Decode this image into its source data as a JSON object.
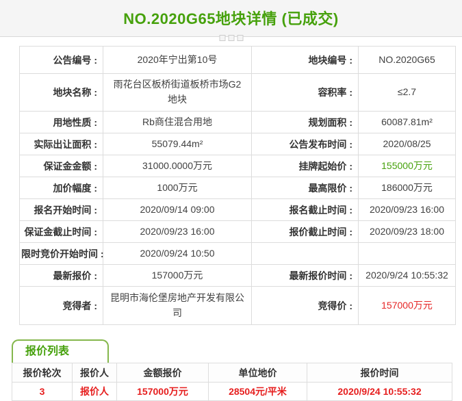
{
  "header": {
    "title": "NO.2020G65地块详情 (已成交)"
  },
  "colors": {
    "accent_green": "#46a10c",
    "highlight_red": "#e62626",
    "border_gray": "#dcdcdc"
  },
  "details": {
    "rows": [
      {
        "label1": "公告编号 :",
        "value1": "2020年宁出第10号",
        "label2": "地块编号 :",
        "value2": "NO.2020G65"
      },
      {
        "label1": "地块名称 :",
        "value1": "雨花台区板桥街道板桥市场G2地块",
        "label2": "容积率 :",
        "value2": "≤2.7"
      },
      {
        "label1": "用地性质 :",
        "value1": "Rb商住混合用地",
        "label2": "规划面积 :",
        "value2": "60087.81m²"
      },
      {
        "label1": "实际出让面积 :",
        "value1": "55079.44m²",
        "label2": "公告发布时间 :",
        "value2": "2020/08/25"
      },
      {
        "label1": "保证金金额 :",
        "value1": "31000.0000万元",
        "label2": "挂牌起始价 :",
        "value2": "155000万元"
      },
      {
        "label1": "加价幅度 :",
        "value1": "1000万元",
        "label2": "最高限价 :",
        "value2": "186000万元"
      },
      {
        "label1": "报名开始时间 :",
        "value1": "2020/09/14 09:00",
        "label2": "报名截止时间 :",
        "value2": "2020/09/23 16:00"
      },
      {
        "label1": "保证金截止时间 :",
        "value1": "2020/09/23 16:00",
        "label2": "报价截止时间 :",
        "value2": "2020/09/23 18:00"
      },
      {
        "label1": "限时竞价开始时间 :",
        "value1": "2020/09/24 10:50",
        "label2": "",
        "value2": ""
      },
      {
        "label1": "最新报价 :",
        "value1": "157000万元",
        "label2": "最新报价时间 :",
        "value2": "2020/9/24 10:55:32"
      },
      {
        "label1": "竞得者 :",
        "value1": "昆明市海伦堡房地产开发有限公司",
        "label2": "竞得价 :",
        "value2": "157000万元"
      }
    ]
  },
  "quote_list": {
    "tab_label": "报价列表",
    "headers": [
      "报价轮次",
      "报价人",
      "金额报价",
      "单位地价",
      "报价时间"
    ],
    "rows": [
      [
        "3",
        "报价人",
        "157000万元",
        "28504元/平米",
        "2020/9/24 10:55:32"
      ]
    ]
  }
}
